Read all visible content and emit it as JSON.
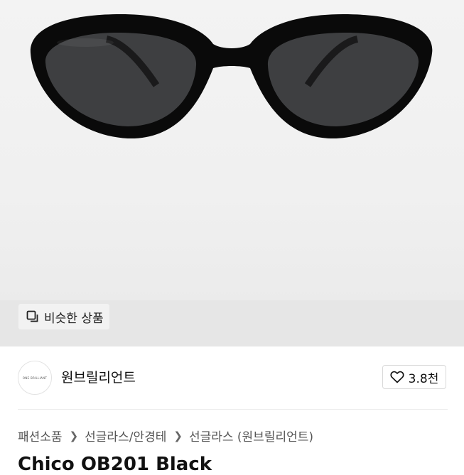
{
  "hero": {
    "image_alt": "black oval sunglasses",
    "similar_products_label": "비슷한 상품",
    "similar_icon": "copy-icon"
  },
  "shop": {
    "logo_text": "ONE BRILLIANT",
    "name": "원브릴리언트",
    "like_icon": "heart-icon",
    "like_count": "3.8천"
  },
  "breadcrumb": [
    "패션소품",
    "선글라스/안경테",
    "선글라스 (원브릴리언트)"
  ],
  "product": {
    "title": "Chico OB201 Black"
  }
}
